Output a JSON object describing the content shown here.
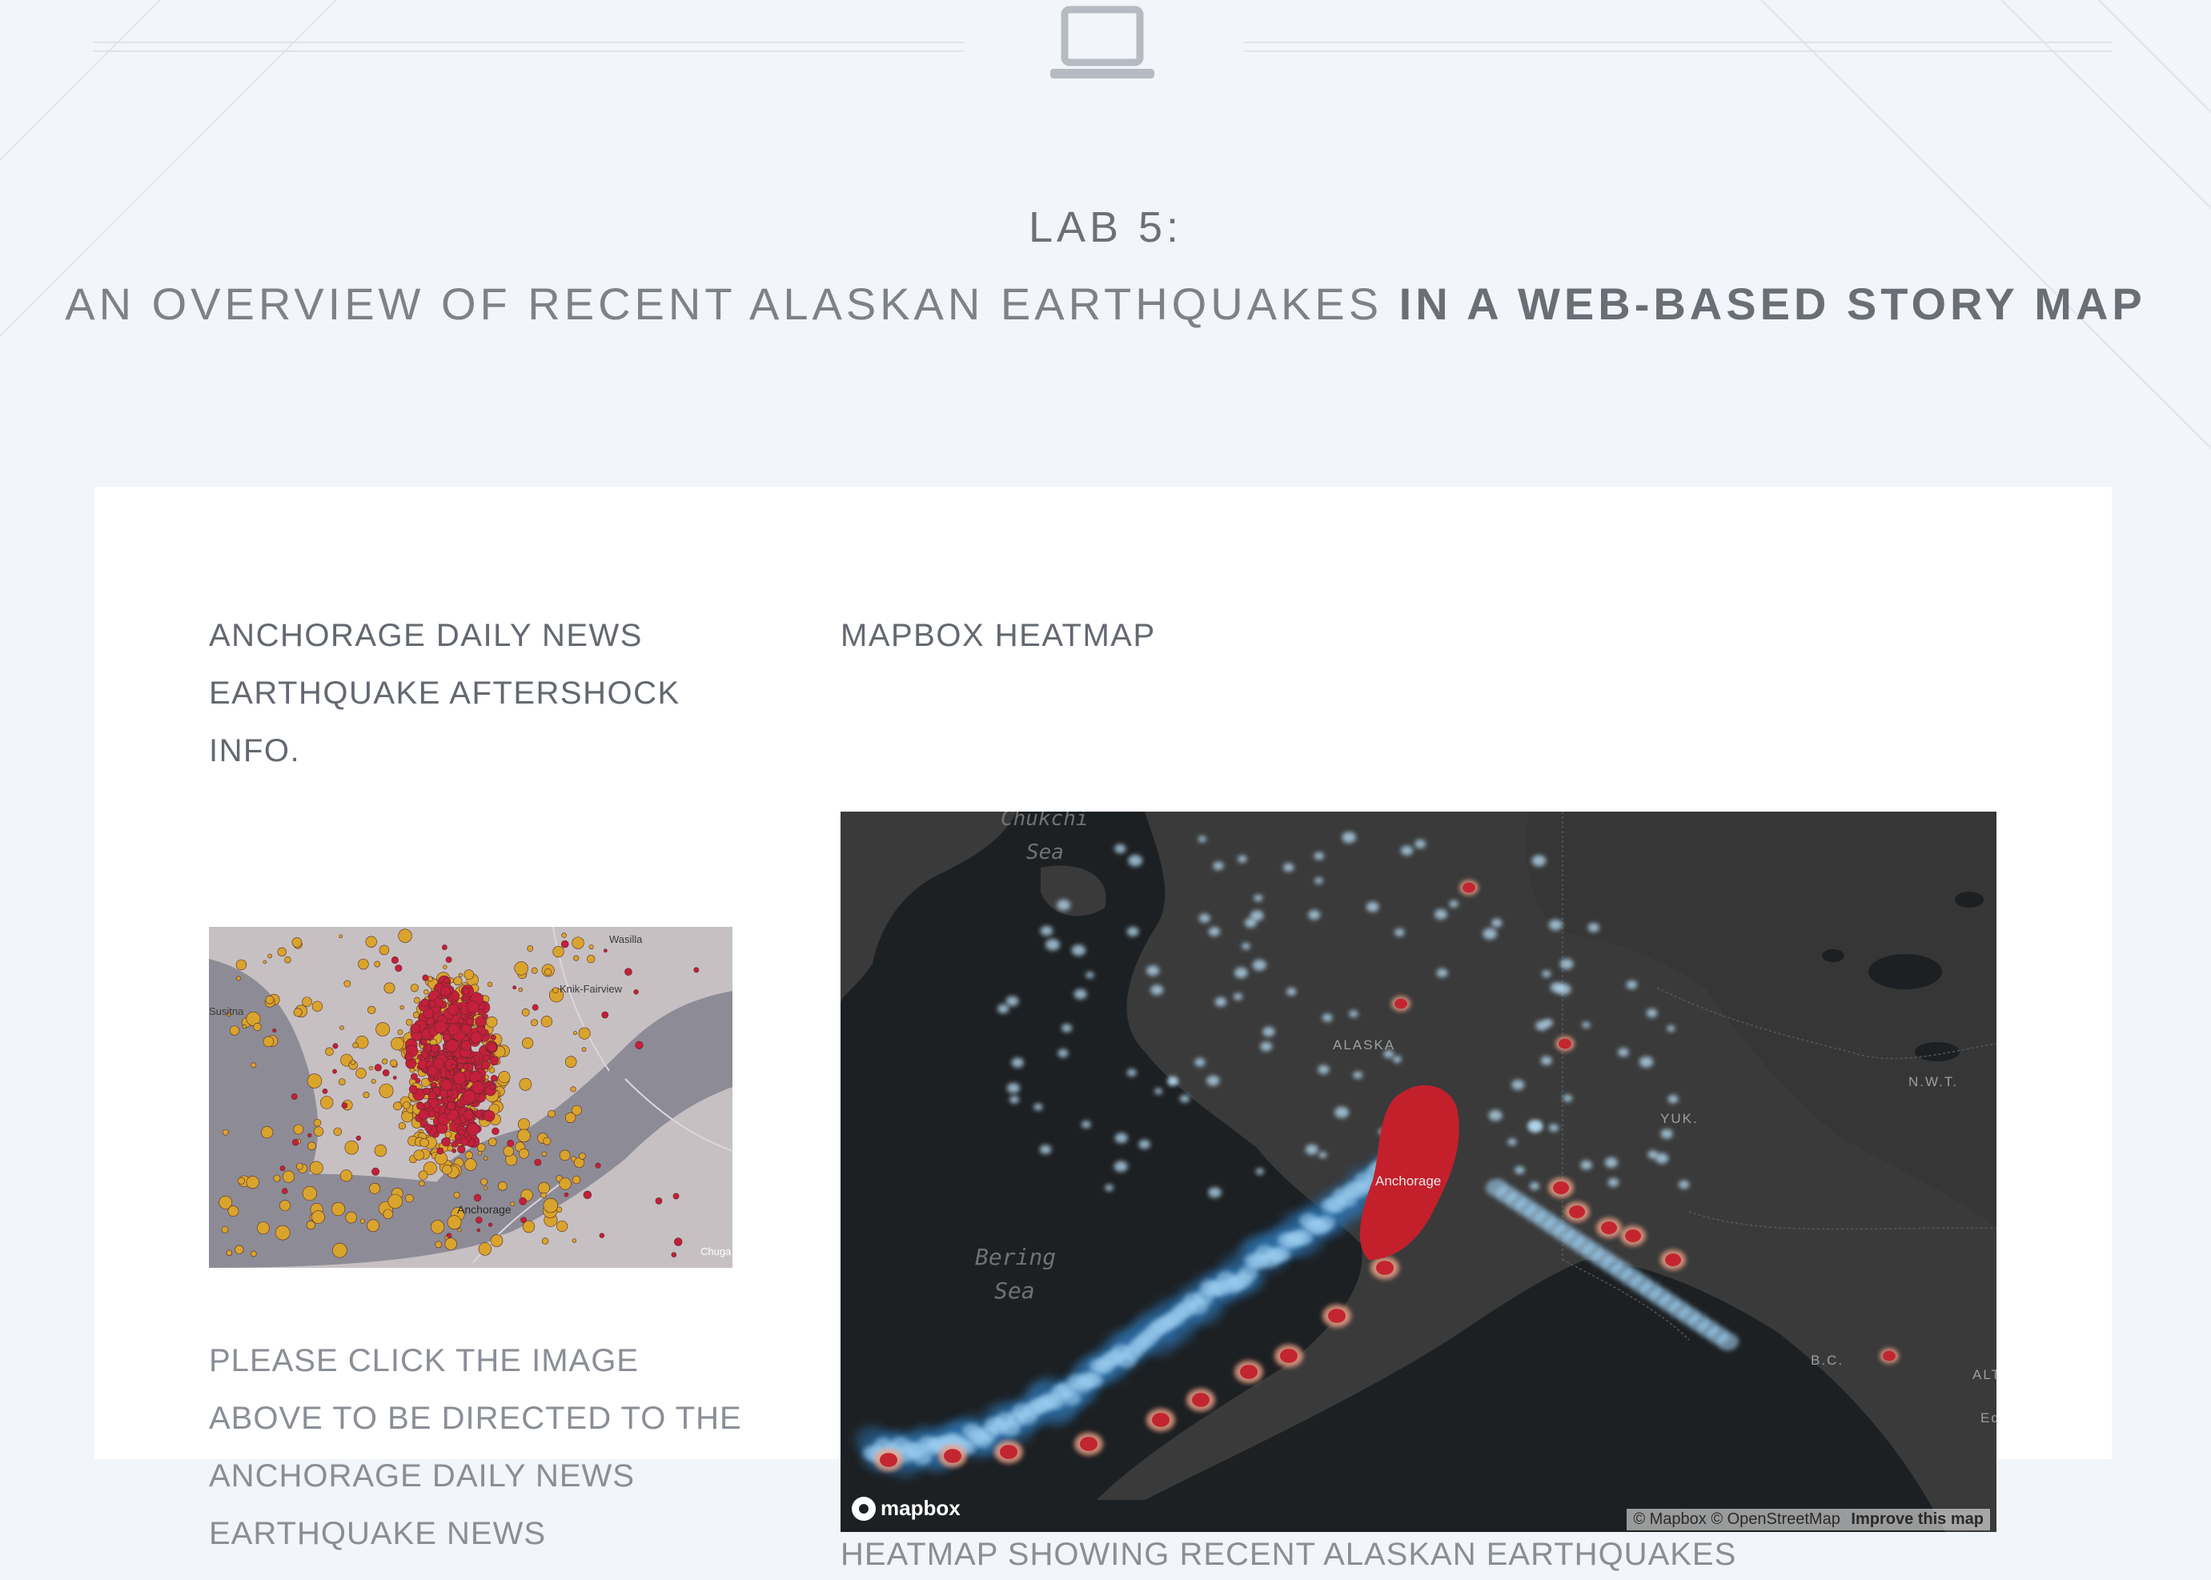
{
  "header": {
    "icon": "laptop-icon",
    "title_line1": "LAB 5:",
    "title_light": "AN OVERVIEW OF RECENT ALASKAN EARTHQUAKES",
    "title_bold": "IN A WEB-BASED STORY MAP"
  },
  "left_section": {
    "heading_lines": [
      "ANCHORAGE DAILY NEWS",
      "EARTHQUAKE AFTERSHOCK",
      "INFO."
    ],
    "image_labels": {
      "wasilla": "Wasilla",
      "knik": "Knik-Fairview",
      "susitna": "Susitna",
      "anchorage": "Anchorage",
      "chugach": "Chuga"
    },
    "note_lines": [
      "PLEASE CLICK THE IMAGE",
      "ABOVE TO BE DIRECTED TO THE",
      "ANCHORAGE DAILY NEWS",
      "EARTHQUAKE NEWS"
    ]
  },
  "right_section": {
    "heading": "MAPBOX HEATMAP",
    "map": {
      "labels": {
        "chukchi": "Chukchi",
        "chukchi_sea": "Sea",
        "bering": "Bering",
        "bering_sea": "Sea",
        "alaska": "ALASKA",
        "anchorage": "Anchorage",
        "yukon": "YUK.",
        "nwt": "N.W.T.",
        "bc": "B.C.",
        "alta": "ALT",
        "edm": "Ed"
      },
      "logo": "mapbox",
      "attribution": "© Mapbox © OpenStreetMap",
      "improve_link": "Improve this map"
    },
    "caption": "HEATMAP SHOWING RECENT ALASKAN EARTHQUAKES"
  }
}
